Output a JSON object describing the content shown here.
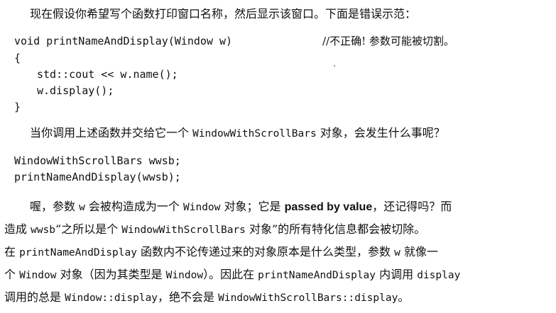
{
  "intro": "现在假设你希望写个函数打印窗口名称，然后显示该窗口。下面是错误示范：",
  "code1": {
    "line1": "void printNameAndDisplay(Window w)",
    "comment": "//不正确! 参数可能被切割。",
    "line2": "{",
    "line3": "std::cout << w.name();",
    "line4": "w.display();",
    "line5": "}"
  },
  "question": {
    "before": "当你调用上述函数并交给它一个 ",
    "code": "WindowWithScrollBars",
    "after": " 对象，会发生什么事呢？"
  },
  "code2": {
    "line1": "WindowWithScrollBars wwsb;",
    "line2": "printNameAndDisplay(wwsb);"
  },
  "para": {
    "l1_a": "喔，参数 ",
    "l1_b": "w",
    "l1_c": " 会被构造成为一个 ",
    "l1_d": "Window",
    "l1_e": " 对象；它是 ",
    "l1_f": "passed by value",
    "l1_g": "，还记得吗？而",
    "l2_a": "造成 ",
    "l2_b": "wwsb",
    "l2_c": "“之所以是个 ",
    "l2_d": "WindowWithScrollBars",
    "l2_e": " 对象”的所有特化信息都会被切除。",
    "l3_a": "在 ",
    "l3_b": "printNameAndDisplay",
    "l3_c": " 函数内不论传递过来的对象原本是什么类型，参数 ",
    "l3_d": "w",
    "l3_e": " 就像一",
    "l4_a": "个 ",
    "l4_b": "Window",
    "l4_c": " 对象（因为其类型是 ",
    "l4_d": "Window",
    "l4_e": "）。因此在 ",
    "l4_f": "printNameAndDisplay",
    "l4_g": " 内调用 ",
    "l4_h": "display",
    "l5_a": "调用的总是 ",
    "l5_b": "Window::display",
    "l5_c": "，绝不会是 ",
    "l5_d": "WindowWithScrollBars::display",
    "l5_e": "。"
  }
}
